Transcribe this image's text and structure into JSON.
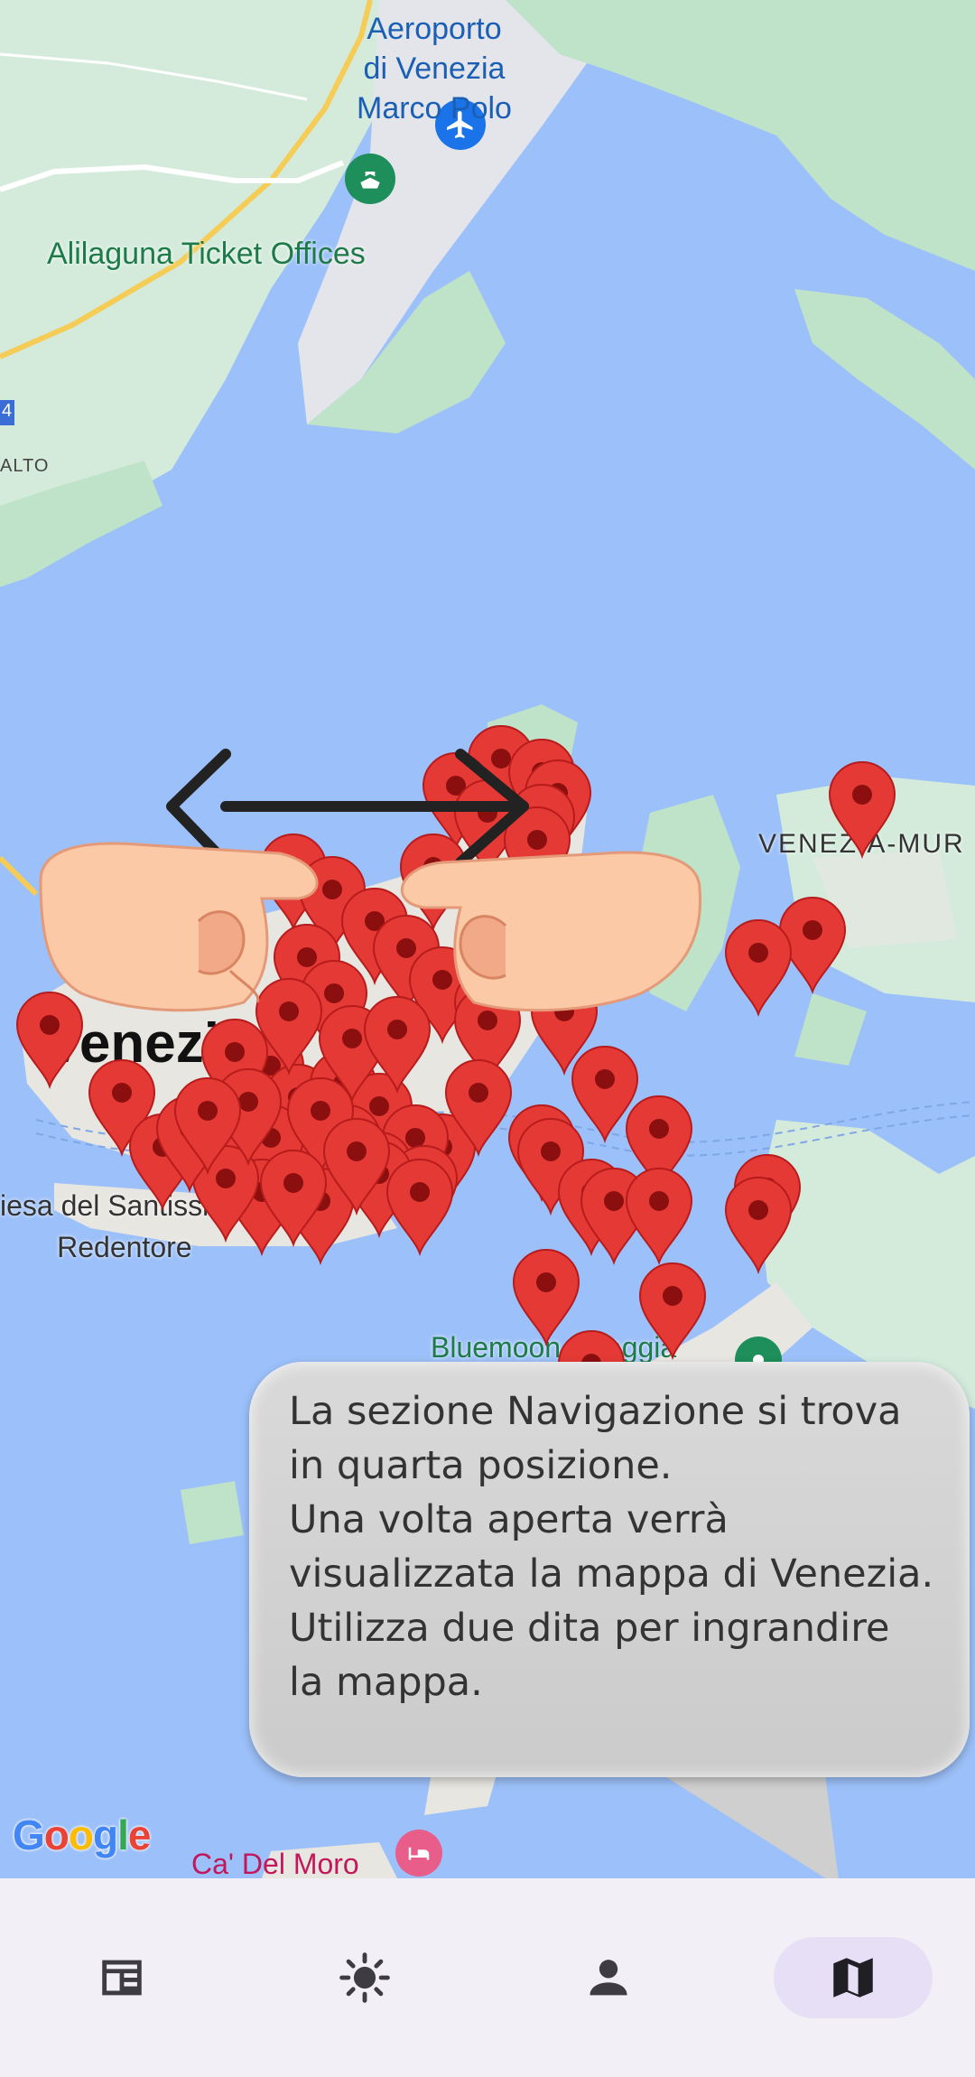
{
  "map": {
    "labels": {
      "airport_line1": "Aeroporto",
      "airport_line2": "di Venezia",
      "airport_line3": "Marco Polo",
      "alilaguna": "Alilaguna Ticket Offices",
      "alto": "ALTO",
      "venezia": "Venezia",
      "murano": "VENEZIA-MUR",
      "chiesa_line1": "iesa del Santissimo",
      "chiesa_line2": "Redentore",
      "bluemoon": "Bluemoon spiaggia",
      "cadelmoro": "Ca' Del Moro",
      "road_marker": "4"
    },
    "attribution": [
      "G",
      "o",
      "o",
      "g",
      "l",
      "e"
    ],
    "colors": {
      "water": "#9cc0f9",
      "land": "#d4ebdc",
      "pin": "#e53935",
      "pin_dot": "#8b0f0f"
    },
    "icons": {
      "airport": "airplane-icon",
      "ferry": "ferry-icon",
      "hotel": "bed-icon"
    }
  },
  "tutorial": {
    "gesture": "pinch-zoom",
    "lines": [
      "La sezione Navigazione si trova",
      "in quarta posizione.",
      "Una volta aperta verrà",
      "visualizzata la mappa di Venezia.",
      "Utilizza due dita per ingrandire",
      "la mappa."
    ]
  },
  "nav": {
    "items": [
      {
        "name": "news",
        "icon": "newspaper-icon",
        "active": false
      },
      {
        "name": "weather",
        "icon": "sun-icon",
        "active": false
      },
      {
        "name": "profile",
        "icon": "person-icon",
        "active": false
      },
      {
        "name": "map",
        "icon": "map-icon",
        "active": true
      }
    ]
  }
}
